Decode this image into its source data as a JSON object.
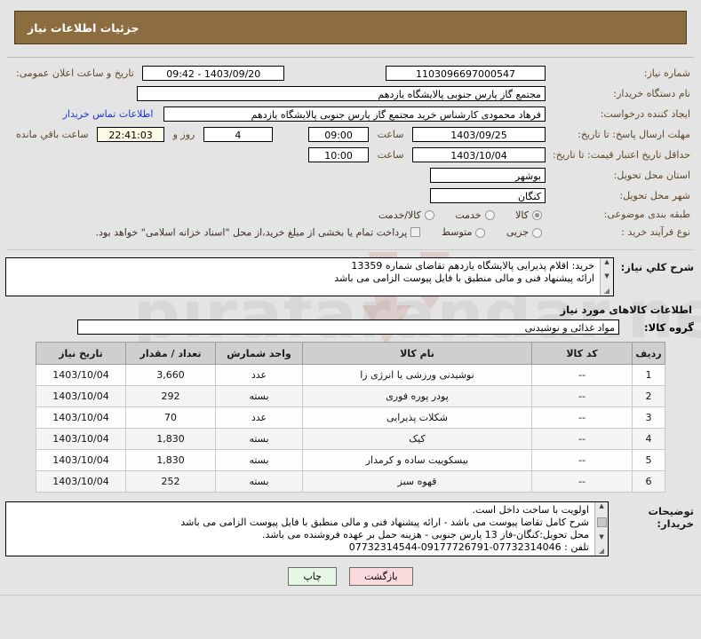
{
  "header": {
    "title": "جزئیات اطلاعات نیاز"
  },
  "form": {
    "need_number_label": "شماره نیاز:",
    "need_number_value": "1103096697000547",
    "announce_label": "تاریخ و ساعت اعلان عمومی:",
    "announce_value": "1403/09/20 - 09:42",
    "buyer_org_label": "نام دستگاه خریدار:",
    "buyer_org_value": "مجتمع گاز پارس جنوبی  پالایشگاه یازدهم",
    "requester_label": "ایجاد کننده درخواست:",
    "requester_value": "فرهاد محمودی کارشناس خرید مجتمع گاز پارس جنوبی  پالایشگاه یازدهم",
    "requester_org_value": "مجتمع گاز پارس جنوبی  پالایشگاه یازدهم",
    "contact_link": "اطلاعات تماس خریدار",
    "deadline_label": "مهلت ارسال پاسخ: تا تاریخ:",
    "deadline_date": "1403/09/25",
    "deadline_time": "09:00",
    "hour_label": "ساعت",
    "days_remaining": "4",
    "days_word": "روز و",
    "time_remaining": "22:41:03",
    "remaining_label": "ساعت باقي مانده",
    "validity_label": "حداقل تاریخ اعتبار قیمت: تا تاریخ:",
    "validity_date": "1403/10/04",
    "validity_time": "10:00",
    "province_label": "استان محل تحویل:",
    "province_value": "بوشهر",
    "city_label": "شهر محل تحویل:",
    "city_value": "کنگان",
    "category_label": "طبقه بندی موضوعی:",
    "category_options": [
      {
        "label": "کالا",
        "selected": true
      },
      {
        "label": "خدمت",
        "selected": false
      },
      {
        "label": "کالا/خدمت",
        "selected": false
      }
    ],
    "process_label": "نوع فرآیند خرید :",
    "process_options": [
      {
        "label": "جزیی",
        "selected": false
      },
      {
        "label": "متوسط",
        "selected": false
      }
    ],
    "treasury_checkbox_label": "پرداخت تمام یا بخشی از مبلغ خرید،از محل \"اسناد خزانه اسلامی\" خواهد بود.",
    "treasury_checked": false
  },
  "description": {
    "label": "شرح کلي نیاز:",
    "lines": [
      "خرید: اقلام پذیرایی  پالایشگاه یازدهم تقاضای شماره 13359",
      "ارائه پیشنهاد فنی و مالی منطبق با فایل پیوست الزامی می باشد"
    ]
  },
  "goods_section": {
    "heading": "اطلاعات کالاهای مورد نیاز",
    "group_label": "گروه کالا:",
    "group_value": "مواد غذائی و نوشیدنی",
    "columns": [
      "ردیف",
      "کد کالا",
      "نام کالا",
      "واحد شمارش",
      "تعداد / مقدار",
      "تاریخ نیاز"
    ],
    "rows": [
      {
        "idx": "1",
        "code": "--",
        "name": "نوشیدنی ورزشی یا انرژی زا",
        "unit": "عدد",
        "qty": "3,660",
        "date": "1403/10/04"
      },
      {
        "idx": "2",
        "code": "--",
        "name": "پودر پوره فوری",
        "unit": "بسته",
        "qty": "292",
        "date": "1403/10/04"
      },
      {
        "idx": "3",
        "code": "--",
        "name": "شکلات پذیرایی",
        "unit": "عدد",
        "qty": "70",
        "date": "1403/10/04"
      },
      {
        "idx": "4",
        "code": "--",
        "name": "کیک",
        "unit": "بسته",
        "qty": "1,830",
        "date": "1403/10/04"
      },
      {
        "idx": "5",
        "code": "--",
        "name": "بیسکوییت ساده و کرمدار",
        "unit": "بسته",
        "qty": "1,830",
        "date": "1403/10/04"
      },
      {
        "idx": "6",
        "code": "--",
        "name": "قهوه سبز",
        "unit": "بسته",
        "qty": "252",
        "date": "1403/10/04"
      }
    ]
  },
  "buyer_notes": {
    "label": "توضیحات خریدار:",
    "lines": [
      "اولویت با ساخت داخل است.",
      "شرح کامل تقاضا پیوست می باشد - ارائه پیشنهاد فنی و مالی منطبق با فایل پیوست الزامی می باشد",
      "محل تحویل:کنگان-فاز 13 پارس جنوبی - هزینه حمل بر عهده فروشنده می باشد.",
      "تلفن : 07732314046-09177726791-07732314544"
    ]
  },
  "buttons": {
    "print": "چاپ",
    "back": "بازگشت"
  },
  "colors": {
    "header_brown": "#8c6d3f",
    "label_brown": "#5c4a2a",
    "link_blue": "#1b37c8",
    "print_green": "#e6f7e6",
    "back_pink": "#fadadd",
    "page_bg": "#e4e4e4"
  },
  "watermark": {
    "text": "pirafarandar.net"
  }
}
